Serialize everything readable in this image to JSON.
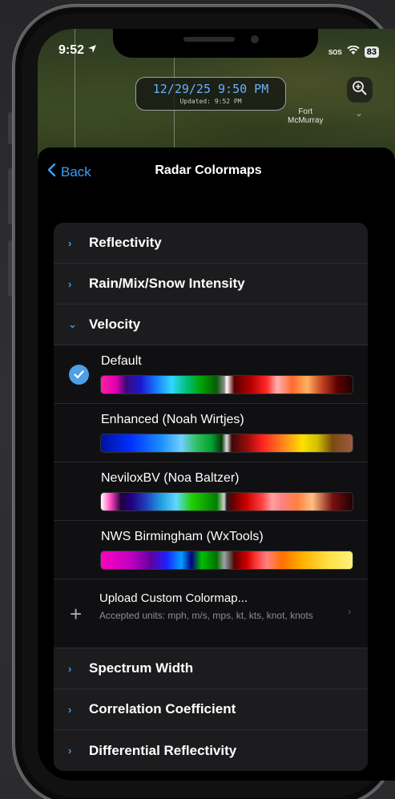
{
  "status": {
    "time": "9:52",
    "sos": "SOS",
    "battery": "83"
  },
  "map": {
    "timestamp": "12/29/25 9:50 PM",
    "updated": "Updated: 9:52 PM",
    "city_line1": "Fort",
    "city_line2": "McMurray"
  },
  "nav": {
    "back_label": "Back",
    "title": "Radar Colormaps"
  },
  "sections_top": [
    {
      "label": "Reflectivity"
    },
    {
      "label": "Rain/Mix/Snow Intensity"
    },
    {
      "label": "Velocity"
    }
  ],
  "velocity_options": [
    {
      "label": "Default",
      "selected": true
    },
    {
      "label": "Enhanced (Noah Wirtjes)",
      "selected": false
    },
    {
      "label": "NeviloxBV (Noa Baltzer)",
      "selected": false
    },
    {
      "label": "NWS Birmingham (WxTools)",
      "selected": false
    }
  ],
  "upload": {
    "title": "Upload Custom Colormap...",
    "subtitle": "Accepted units: mph, m/s, mps, kt, kts, knot, knots"
  },
  "sections_bottom": [
    {
      "label": "Spectrum Width"
    },
    {
      "label": "Correlation Coefficient"
    },
    {
      "label": "Differential Reflectivity"
    }
  ],
  "colors": {
    "accent": "#3c9dff",
    "check": "#4e9fe6",
    "timestamp": "#63b3ff"
  }
}
